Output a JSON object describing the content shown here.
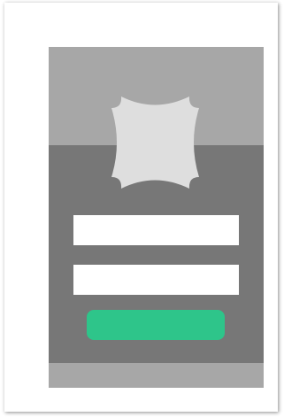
{
  "login_mockup": {
    "logo": {
      "icon": "decorative-badge-icon"
    },
    "username_field": {
      "value": "",
      "placeholder": ""
    },
    "password_field": {
      "value": "",
      "placeholder": ""
    },
    "submit_button": {
      "label": ""
    }
  },
  "colors": {
    "card_background": "#ffffff",
    "screen_background": "#777777",
    "header_band": "#a7a7a7",
    "footer_band": "#a7a7a7",
    "logo_fill": "#dedede",
    "input_background": "#ffffff",
    "button_accent": "#2ec58a"
  }
}
